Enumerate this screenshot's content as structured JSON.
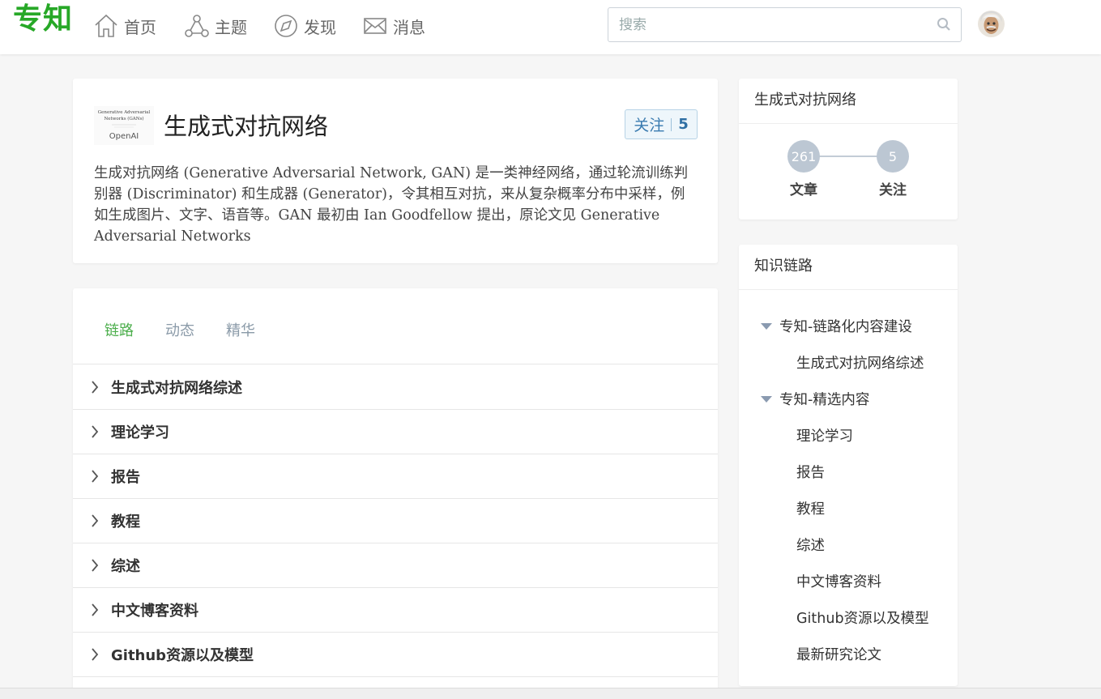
{
  "header": {
    "logo": "专知",
    "nav": [
      {
        "label": "首页",
        "icon": "home-icon"
      },
      {
        "label": "主题",
        "icon": "topic-icon"
      },
      {
        "label": "发现",
        "icon": "compass-icon"
      },
      {
        "label": "消息",
        "icon": "mail-icon"
      }
    ],
    "search_placeholder": "搜索"
  },
  "topic": {
    "title": "生成式对抗网络",
    "thumb_lines": [
      "Generative Adversarial",
      "Networks (GANs)",
      "OpenAI"
    ],
    "follow_label": "关注",
    "follow_count": "5",
    "description": "生成对抗网络 (Generative Adversarial Network, GAN) 是一类神经网络，通过轮流训练判别器 (Discriminator) 和生成器 (Generator)，令其相互对抗，来从复杂概率分布中采样，例如生成图片、文字、语音等。GAN 最初由 Ian Goodfellow 提出，原论文见 Generative Adversarial Networks"
  },
  "tabs": [
    {
      "label": "链路",
      "active": true
    },
    {
      "label": "动态",
      "active": false
    },
    {
      "label": "精华",
      "active": false
    }
  ],
  "list_items": [
    "生成式对抗网络综述",
    "理论学习",
    "报告",
    "教程",
    "综述",
    "中文博客资料",
    "Github资源以及模型"
  ],
  "stats": {
    "title": "生成式对抗网络",
    "articles_count": "261",
    "articles_label": "文章",
    "follow_count": "5",
    "follow_label": "关注"
  },
  "knowledge_chain": {
    "title": "知识链路",
    "groups": [
      {
        "label": "专知-链路化内容建设",
        "children": [
          "生成式对抗网络综述"
        ]
      },
      {
        "label": "专知-精选内容",
        "children": [
          "理论学习",
          "报告",
          "教程",
          "综述",
          "中文博客资料",
          "Github资源以及模型",
          "最新研究论文"
        ]
      }
    ]
  },
  "colors": {
    "brand_green": "#27a827",
    "active_tab": "#4cae4c",
    "follow_blue": "#3a7bb0",
    "stat_circle": "#bcc7d3"
  }
}
